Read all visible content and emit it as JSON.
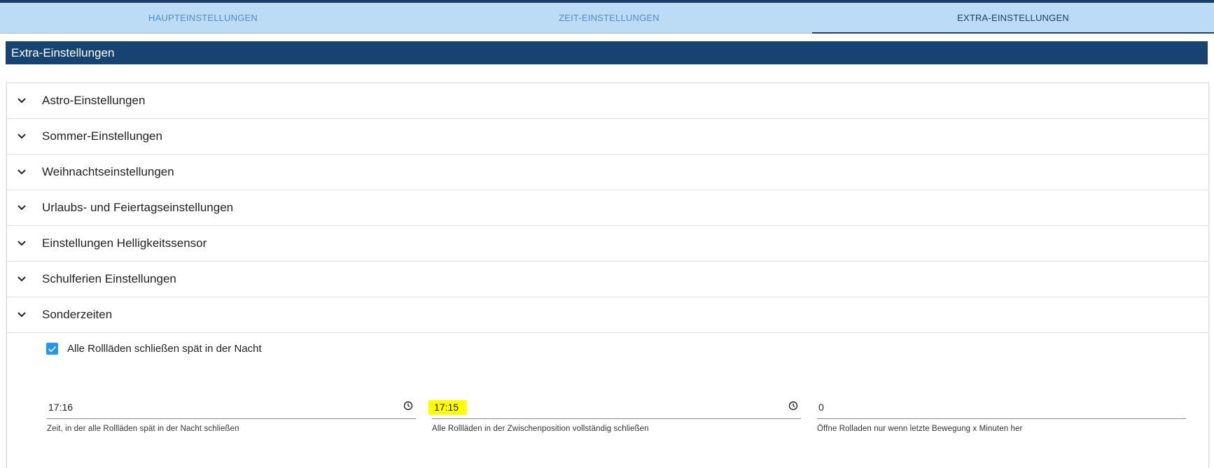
{
  "tabs": [
    {
      "label": "HAUPTEINSTELLUNGEN",
      "active": false
    },
    {
      "label": "ZEIT-EINSTELLUNGEN",
      "active": false
    },
    {
      "label": "EXTRA-EINSTELLUNGEN",
      "active": true
    }
  ],
  "header": {
    "title": "Extra-Einstellungen"
  },
  "accordion": [
    {
      "label": "Astro-Einstellungen",
      "expanded": false
    },
    {
      "label": "Sommer-Einstellungen",
      "expanded": false
    },
    {
      "label": "Weihnachtseinstellungen",
      "expanded": false
    },
    {
      "label": "Urlaubs- und Feiertagseinstellungen",
      "expanded": false
    },
    {
      "label": "Einstellungen Helligkeitssensor",
      "expanded": false
    },
    {
      "label": "Schulferien Einstellungen",
      "expanded": false
    },
    {
      "label": "Sonderzeiten",
      "expanded": true
    }
  ],
  "sonderzeiten": {
    "checkbox_label": "Alle Rollläden schließen spät in der Nacht",
    "checkbox_checked": true,
    "fields": [
      {
        "value": "17:16",
        "help": "Zeit, in der alle Rollläden spät in der Nacht schließen",
        "icon": "clock-icon"
      },
      {
        "value": "17:15",
        "help": "Alle Rollläden in der Zwischenposition vollständig schließen",
        "icon": "clock-icon",
        "highlight": "#ffff00"
      },
      {
        "value": "0",
        "help": "Öffne Rolladen nur wenn letzte Bewegung x Minuten her"
      }
    ]
  },
  "colors": {
    "accent": "#174373",
    "tab_bg": "#bcdcf5",
    "tab_text": "#4a8fd4",
    "checkbox": "#2196f3"
  }
}
